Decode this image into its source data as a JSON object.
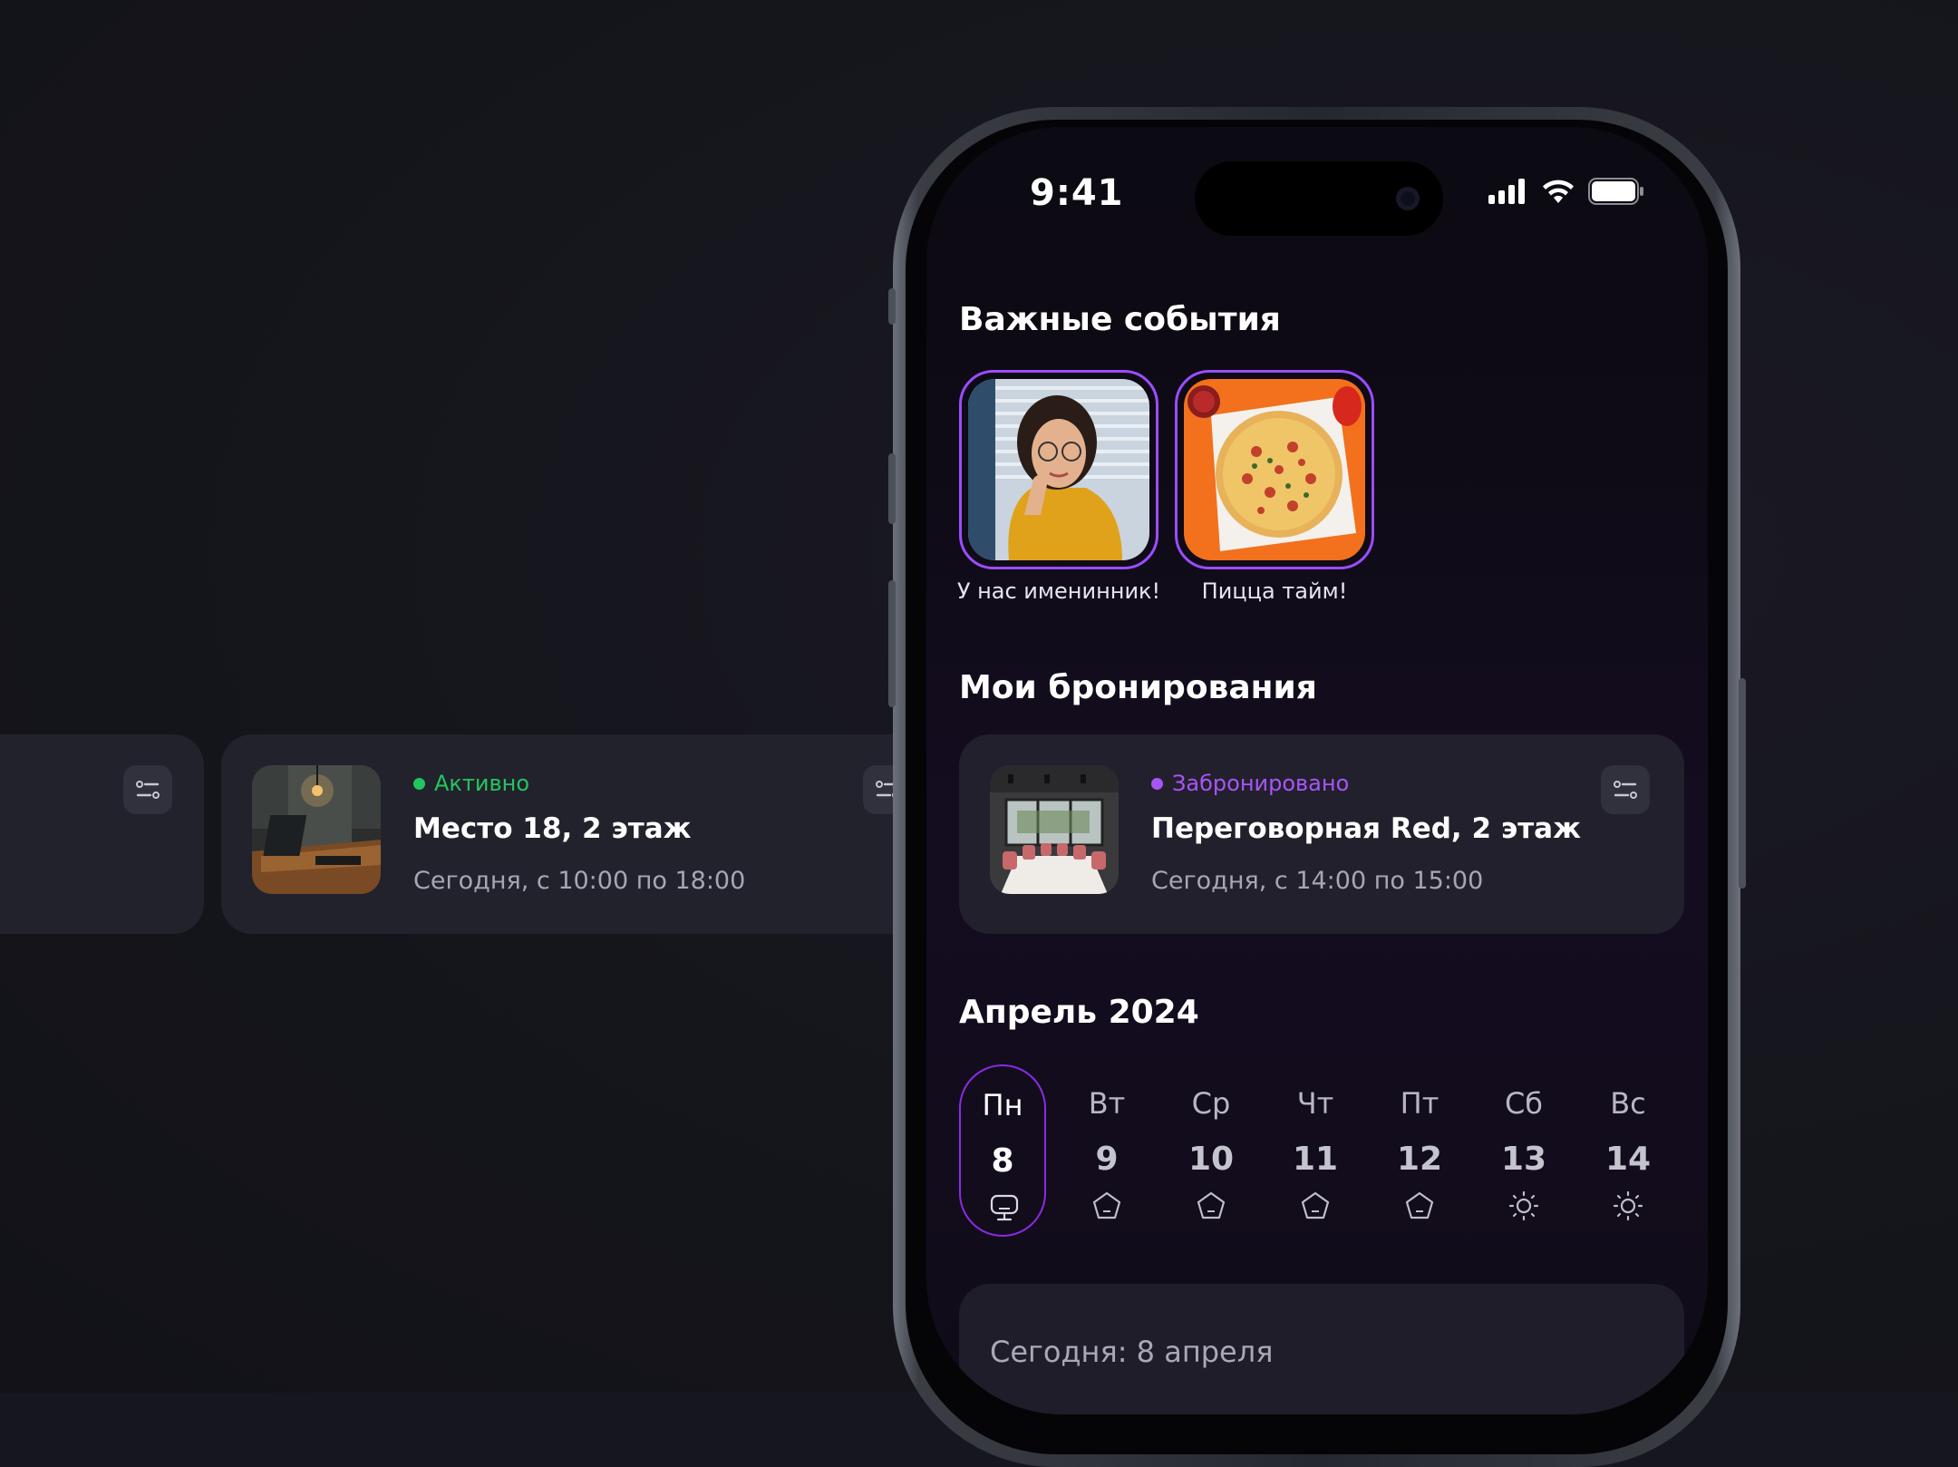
{
  "status_bar": {
    "time": "9:41"
  },
  "events": {
    "title": "Важные события",
    "items": [
      {
        "label": "У нас именинник!",
        "image": "girl-photo"
      },
      {
        "label": "Пицца тайм!",
        "image": "pizza-photo"
      }
    ]
  },
  "bookings": {
    "title": "Мои бронирования",
    "cards": [
      {
        "status": "Активно",
        "status_color": "#22c55e",
        "title": "Место 18, 2 этаж",
        "time": "Сегодня, с 10:00 по 18:00",
        "image": "desk-photo"
      },
      {
        "status": "Забронировано",
        "status_color": "#a855f7",
        "title": "Переговорная Red, 2 этаж",
        "time": "Сегодня, с 14:00 по 15:00",
        "image": "meeting-room-photo"
      }
    ]
  },
  "calendar": {
    "title": "Апрель 2024",
    "days": [
      {
        "name": "Пн",
        "date": "8",
        "icon": "monitor-icon",
        "selected": true
      },
      {
        "name": "Вт",
        "date": "9",
        "icon": "cloud-icon"
      },
      {
        "name": "Ср",
        "date": "10",
        "icon": "cloud-icon"
      },
      {
        "name": "Чт",
        "date": "11",
        "icon": "cloud-icon"
      },
      {
        "name": "Пт",
        "date": "12",
        "icon": "cloud-icon"
      },
      {
        "name": "Сб",
        "date": "13",
        "icon": "sun-icon"
      },
      {
        "name": "Вс",
        "date": "14",
        "icon": "sun-icon"
      }
    ],
    "today_label": "Сегодня: 8 апреля"
  },
  "colors": {
    "accent": "#8a2be2",
    "active": "#22c55e",
    "booked": "#a855f7",
    "background": "#16161e"
  }
}
